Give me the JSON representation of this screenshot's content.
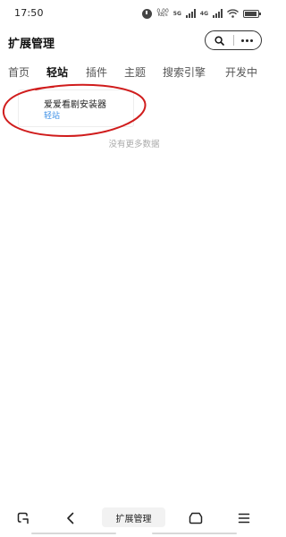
{
  "status_bar": {
    "time": "17:50",
    "net_speed_value": "0.00",
    "net_speed_unit": "KB/s",
    "signal_label_1": "5G",
    "signal_label_2": "4G",
    "icons": [
      "alarm-icon",
      "net-speed-icon",
      "signal-icon",
      "signal-icon",
      "wifi-icon",
      "battery-icon"
    ]
  },
  "header": {
    "title": "扩展管理",
    "search_icon": "search-icon",
    "more_icon": "more-icon"
  },
  "tabs": [
    {
      "label": "首页",
      "active": false
    },
    {
      "label": "轻站",
      "active": true
    },
    {
      "label": "插件",
      "active": false
    },
    {
      "label": "主题",
      "active": false
    },
    {
      "label": "搜索引擎",
      "active": false
    },
    {
      "label": "开发中",
      "active": false
    }
  ],
  "list": {
    "items": [
      {
        "title": "爱爱看剧安装器",
        "subtitle": "轻站"
      }
    ],
    "end_text": "没有更多数据"
  },
  "bottom_nav": {
    "title": "扩展管理",
    "icons": [
      "back-corner-icon",
      "back-arrow-icon",
      "home-icon",
      "menu-icon"
    ]
  },
  "colors": {
    "accent": "#3a8ee6",
    "annotation": "#d01c1c",
    "text": "#222222",
    "muted": "#aaaaaa"
  }
}
